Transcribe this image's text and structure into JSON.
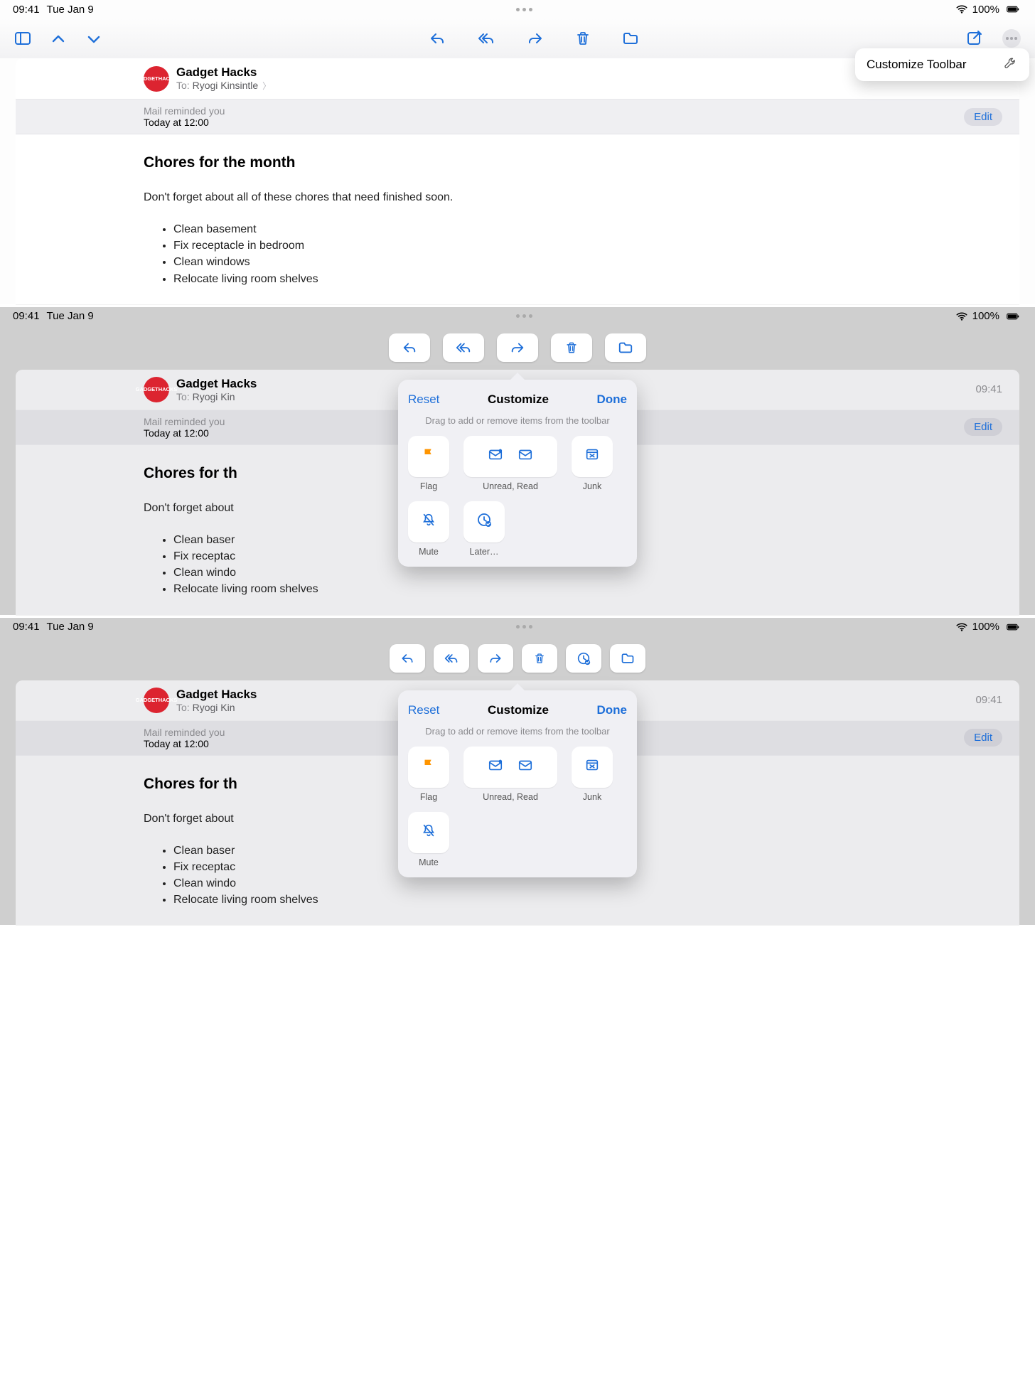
{
  "status": {
    "time": "09:41",
    "date": "Tue Jan 9",
    "battery": "100%"
  },
  "popover": {
    "customize_toolbar": "Customize Toolbar"
  },
  "mail": {
    "avatar_line1": "GADGET",
    "avatar_line2": "HACKS",
    "sender": "Gadget Hacks",
    "to_prefix": "To:",
    "to_name": "Ryogi Kinsintle",
    "to_name_short": "Ryogi Kin",
    "reminded": "Mail reminded you",
    "reminded_time": "Today at 12:00",
    "edit": "Edit",
    "timestamp": "09:41",
    "subject": "Chores for the month",
    "intro": "Don't forget about all of these chores that need finished soon.",
    "intro_cut": "Don't forget about",
    "subject_cut": "Chores for th",
    "items": [
      "Clean basement",
      "Fix receptacle in bedroom",
      "Clean windows",
      "Relocate living room shelves"
    ],
    "items_cut": [
      "Clean baser",
      "Fix receptac",
      "Clean windo",
      "Relocate living room shelves"
    ]
  },
  "customize": {
    "reset": "Reset",
    "title": "Customize",
    "done": "Done",
    "subtitle": "Drag to add or remove items from the toolbar",
    "flag": "Flag",
    "unread_read": "Unread, Read",
    "junk": "Junk",
    "mute": "Mute",
    "later": "Later…"
  }
}
